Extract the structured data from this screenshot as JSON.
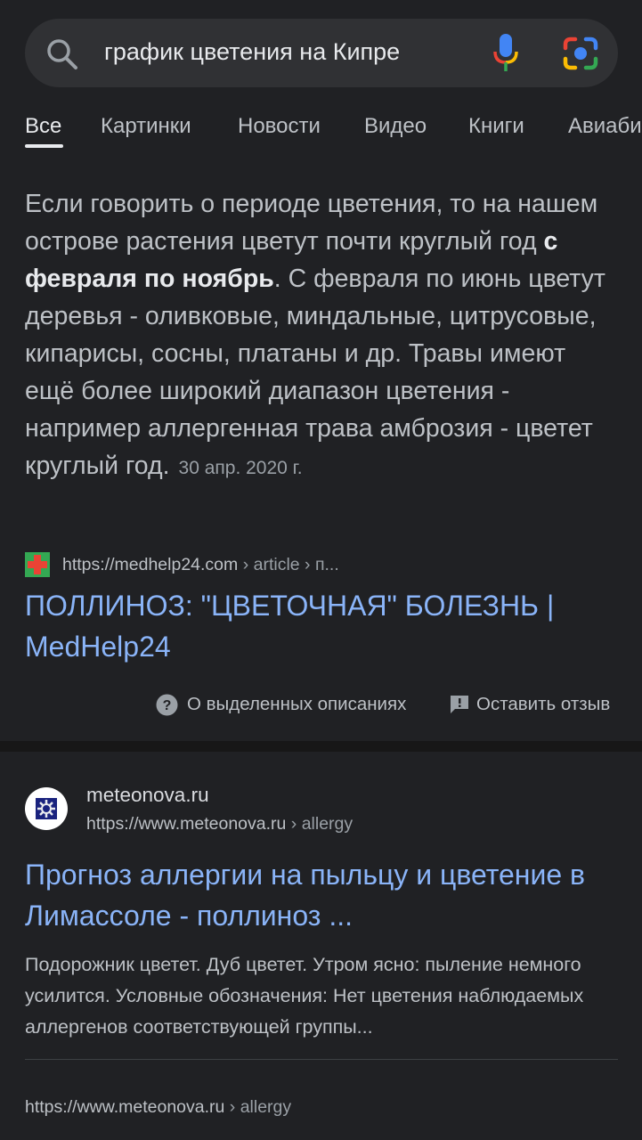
{
  "search": {
    "query": "график цветения на Кипре"
  },
  "tabs": [
    {
      "label": "Все",
      "active": true
    },
    {
      "label": "Картинки"
    },
    {
      "label": "Новости"
    },
    {
      "label": "Видео"
    },
    {
      "label": "Книги"
    },
    {
      "label": "Авиаби"
    }
  ],
  "featured_snippet": {
    "text_before": "Если говорить о периоде цветения, то на нашем острове растения цветут почти круглый год ",
    "text_bold": "с февраля по ноябрь",
    "text_after": ". С февраля по июнь цветут деревья - оливковые, миндальные, цитрусовые, кипарисы, сосны, платаны и др. Травы имеют ещё более широкий диапазон цветения - например аллергенная трава амброзия - цветет круглый год.",
    "date": "30 апр. 2020 г.",
    "source_url": "https://medhelp24.com",
    "source_breadcrumb": " › article › п...",
    "title": "ПОЛЛИНОЗ: \"ЦВЕТОЧНАЯ\" БОЛЕЗНЬ | MedHelp24",
    "about_label": "О выделенных описаниях",
    "feedback_label": "Оставить отзыв"
  },
  "result": {
    "site_name": "meteonova.ru",
    "url": "https://www.meteonova.ru",
    "breadcrumb": " › allergy",
    "title": "Прогноз аллергии на пыльцу и цветение в Лимассоле - поллиноз ...",
    "description": "Подорожник цветет. Дуб цветет. Утром ясно: пыление немного усилится. Условные обозначения: Нет цветения наблюдаемых аллергенов соответствующей группы...",
    "sub_url": "https://www.meteonova.ru",
    "sub_breadcrumb": " › allergy"
  },
  "colors": {
    "background": "#202124",
    "link": "#8ab4f8",
    "text": "#bdc1c6"
  }
}
